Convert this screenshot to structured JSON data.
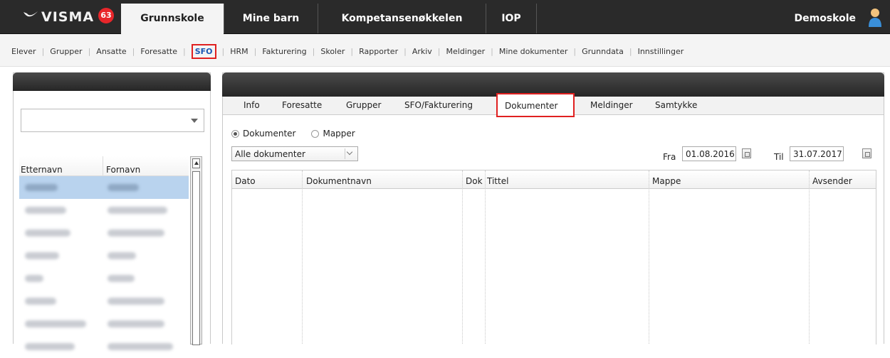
{
  "app": {
    "logo_text": "VISMA",
    "notification_count": "63",
    "main_tabs": [
      "Grunnskole",
      "Mine barn",
      "Kompetansenøkkelen",
      "IOP"
    ],
    "active_main_tab": "Grunnskole",
    "school_name": "Demoskole"
  },
  "subnav": {
    "items": [
      "Elever",
      "Grupper",
      "Ansatte",
      "Foresatte",
      "SFO",
      "HRM",
      "Fakturering",
      "Skoler",
      "Rapporter",
      "Arkiv",
      "Meldinger",
      "Mine dokumenter",
      "Grunndata",
      "Innstillinger"
    ],
    "active": "SFO"
  },
  "left_panel": {
    "filter_value": "",
    "columns": [
      "Etternavn",
      "Fornavn"
    ],
    "selected_row_index": 0
  },
  "right_panel": {
    "tabs": [
      "Info",
      "Foresatte",
      "Grupper",
      "SFO/Fakturering",
      "Dokumenter",
      "Meldinger",
      "Samtykke"
    ],
    "active_tab": "Dokumenter",
    "radio_options": [
      "Dokumenter",
      "Mapper"
    ],
    "radio_selected": "Dokumenter",
    "doc_filter": "Alle dokumenter",
    "from_label": "Fra",
    "from_date": "01.08.2016",
    "to_label": "Til",
    "to_date": "31.07.2017",
    "table_columns": [
      "Dato",
      "Dokumentnavn",
      "Dok",
      "Tittel",
      "Mappe",
      "Avsender"
    ]
  },
  "colors": {
    "topbar": "#2a2a2a",
    "highlight_border": "#e02020",
    "selected_row": "#b9d3ee",
    "badge": "#e8262a"
  }
}
